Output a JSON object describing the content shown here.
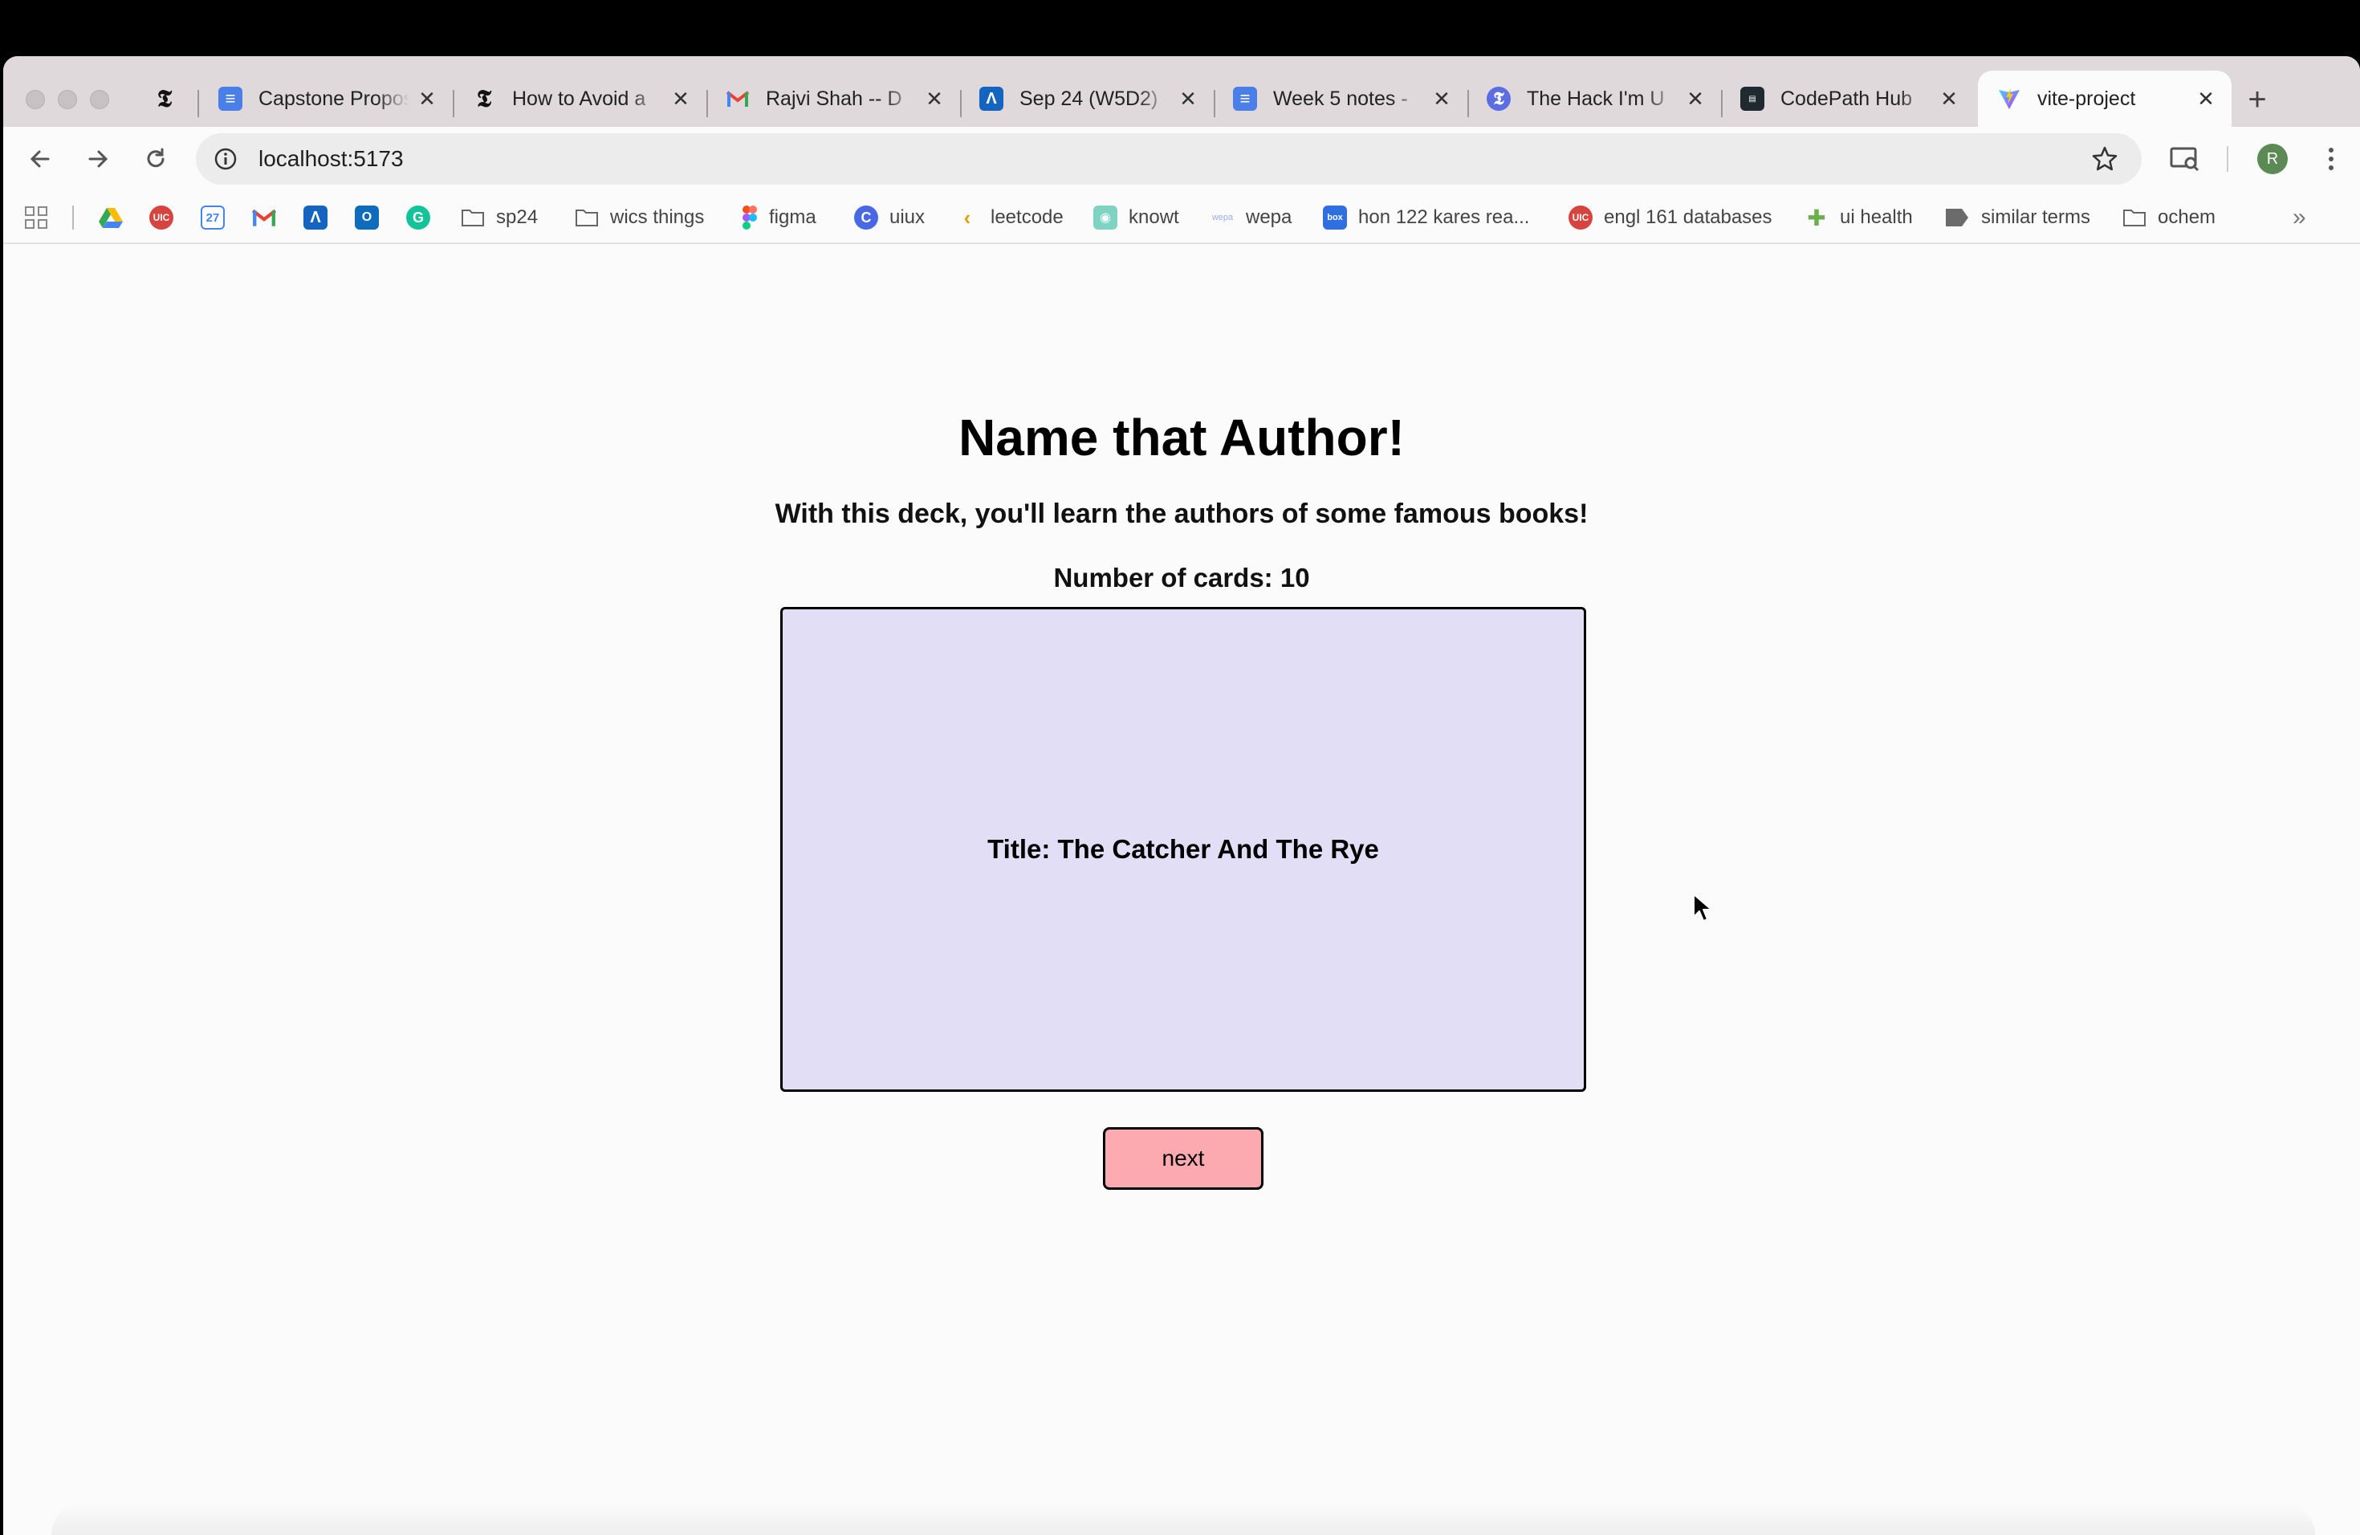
{
  "browser": {
    "tabs": [
      {
        "title": "",
        "icon": "nyt-icon"
      },
      {
        "title": "Capstone Proposal",
        "icon": "google-docs-icon"
      },
      {
        "title": "How to Avoid a",
        "icon": "nyt-icon"
      },
      {
        "title": "Rajvi Shah -- D",
        "icon": "gmail-icon"
      },
      {
        "title": "Sep 24 (W5D2)",
        "icon": "canvas-icon"
      },
      {
        "title": "Week 5 notes -",
        "icon": "google-docs-icon"
      },
      {
        "title": "The Hack I'm U",
        "icon": "nyt-cooking-icon"
      },
      {
        "title": "CodePath Hub",
        "icon": "codepath-icon"
      },
      {
        "title": "vite-project",
        "icon": "vite-icon"
      }
    ],
    "active_tab": 8,
    "url": "localhost:5173",
    "profile_initial": "R",
    "bookmarks": [
      {
        "label": "sp24",
        "icon": "folder-icon"
      },
      {
        "label": "wics things",
        "icon": "folder-icon"
      },
      {
        "label": "figma",
        "icon": "figma-icon"
      },
      {
        "label": "uiux",
        "icon": "link-icon"
      },
      {
        "label": "leetcode",
        "icon": "leetcode-icon"
      },
      {
        "label": "knowt",
        "icon": "knowt-icon"
      },
      {
        "label": "wepa",
        "icon": "wepa-icon"
      },
      {
        "label": "hon 122 kares rea...",
        "icon": "box-icon"
      },
      {
        "label": "engl 161 databases",
        "icon": "uic-icon"
      },
      {
        "label": "ui health",
        "icon": "ui-health-icon"
      },
      {
        "label": "similar terms",
        "icon": "tag-icon"
      },
      {
        "label": "ochem",
        "icon": "folder-icon"
      }
    ],
    "bookmark_icon_apps": [
      "apps-icon",
      "google-drive-icon",
      "uic-icon",
      "google-calendar-icon",
      "gmail-icon",
      "canvas-icon",
      "outlook-icon",
      "grammarly-icon"
    ],
    "calendar_day": "27"
  },
  "page": {
    "title": "Name that Author!",
    "subtitle": "With this deck, you'll learn the authors of some famous books!",
    "card_count": "Number of cards: 10",
    "card_text": "Title: The Catcher And The Rye",
    "next_label": "next"
  },
  "colors": {
    "card_bg": "#e1def5",
    "next_bg": "#fda9b0",
    "tabstrip_bg": "#dfd9db"
  }
}
